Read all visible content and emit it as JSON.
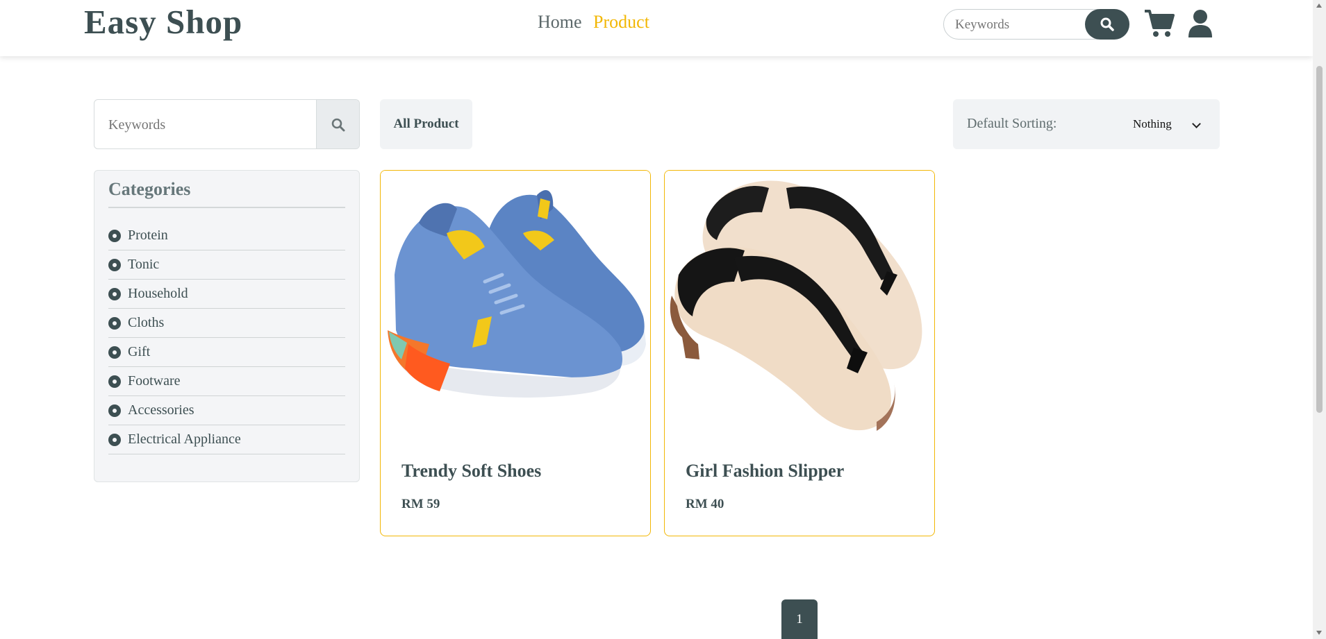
{
  "header": {
    "logo": "Easy Shop",
    "nav": [
      {
        "label": "Home"
      },
      {
        "label": "Product"
      }
    ],
    "search_placeholder": "Keywords",
    "icons": [
      "search-icon",
      "cart-icon",
      "user-icon"
    ],
    "accent_color": "#f2b705",
    "brand_color": "#3d4f52"
  },
  "sidebar": {
    "search_placeholder": "Keywords",
    "categories_title": "Categories",
    "categories": [
      "Protein",
      "Tonic",
      "Household",
      "Cloths",
      "Gift",
      "Footware",
      "Accessories",
      "Electrical Appliance"
    ]
  },
  "main": {
    "tab_label": "All Product",
    "sorting_label": "Default Sorting:",
    "sorting_value": "Nothing",
    "products": [
      {
        "name": "Trendy Soft Shoes",
        "price": "RM 59"
      },
      {
        "name": "Girl Fashion Slipper",
        "price": "RM 40"
      }
    ],
    "pagination": {
      "current_page": "1"
    }
  }
}
